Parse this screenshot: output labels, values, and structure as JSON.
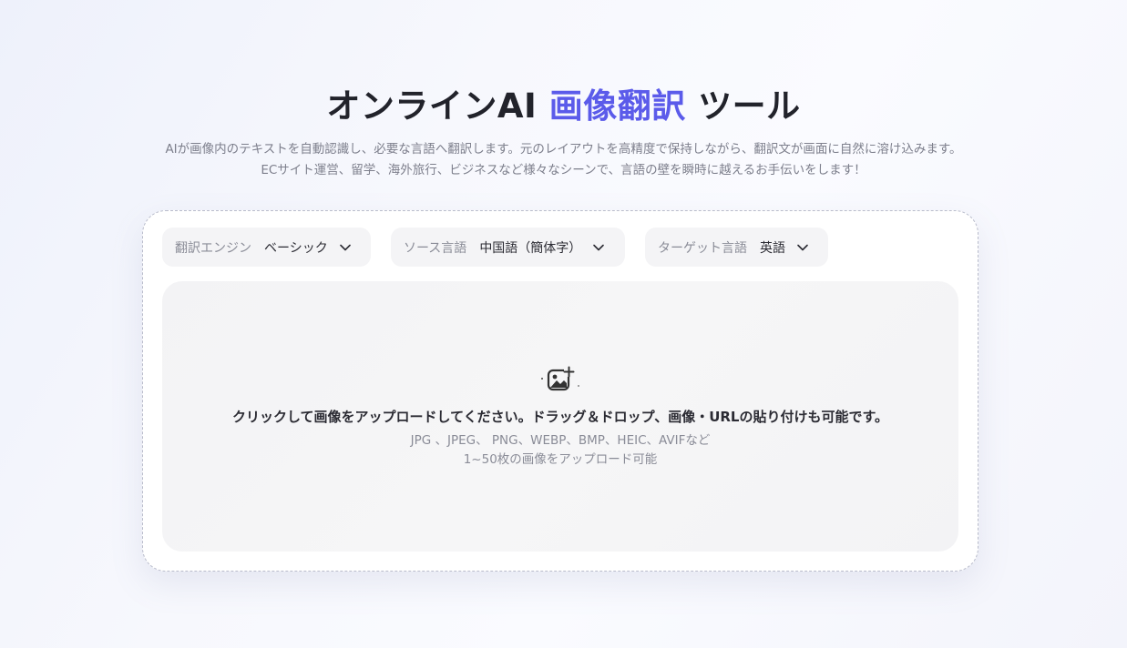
{
  "header": {
    "title_prefix": "オンラインAI ",
    "title_accent": "画像翻訳",
    "title_suffix": " ツール",
    "accent_color": "#5b5bea",
    "subtitle_line1": "AIが画像内のテキストを自動認識し、必要な言語へ翻訳します。元のレイアウトを高精度で保持しながら、翻訳文が画面に自然に溶け込みます。",
    "subtitle_line2": "ECサイト運営、留学、海外旅行、ビジネスなど様々なシーンで、言語の壁を瞬時に越えるお手伝いをします！"
  },
  "selectors": {
    "engine": {
      "label": "翻訳エンジン",
      "value": "ベーシック",
      "icon": "chevron-down-icon"
    },
    "source": {
      "label": "ソース言語",
      "value": "中国語（簡体字）",
      "icon": "chevron-down-icon"
    },
    "target": {
      "label": "ターゲット言語",
      "value": "英語",
      "icon": "chevron-down-icon"
    }
  },
  "upload": {
    "icon": "image-add-icon",
    "main_text": "クリックして画像をアップロードしてください。ドラッグ＆ドロップ、画像・URLの貼り付けも可能です。",
    "formats_text": "JPG 、JPEG、 PNG、WEBP、BMP、HEIC、AVIFなど",
    "count_text": "1~50枚の画像をアップロード可能"
  }
}
